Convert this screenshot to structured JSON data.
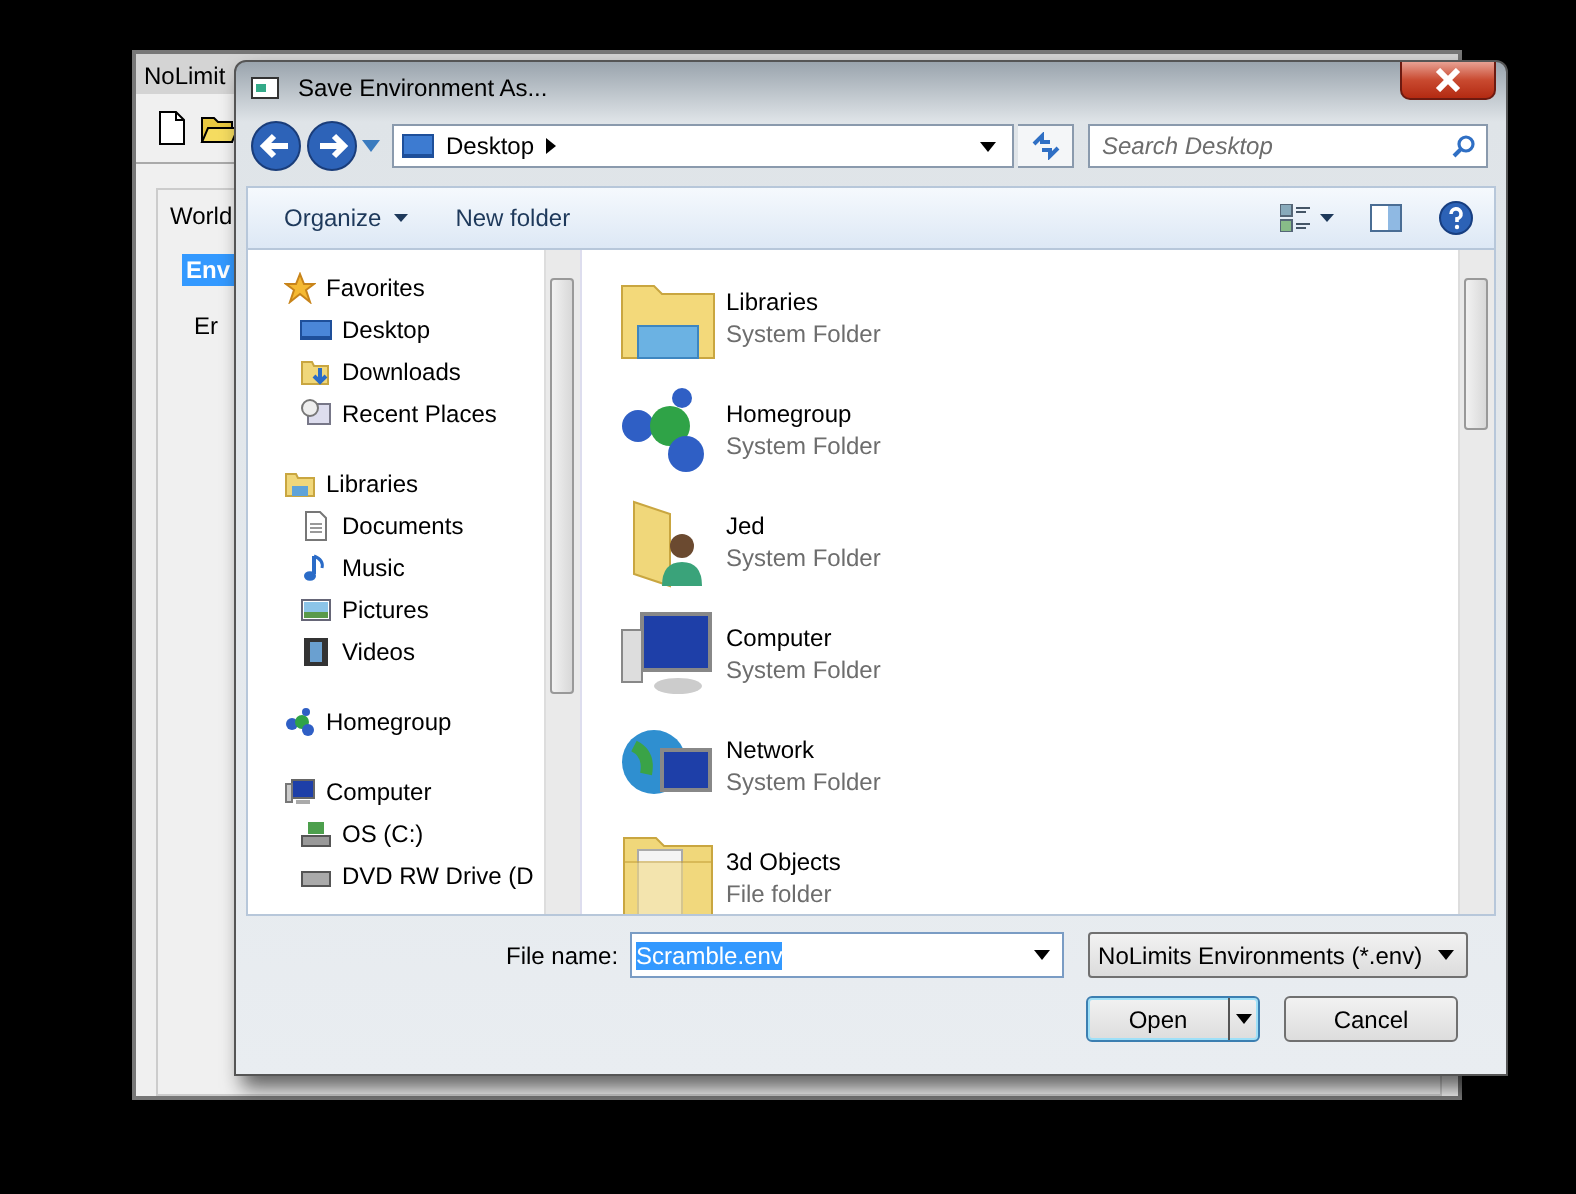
{
  "background_window": {
    "title": "NoLimit",
    "tab_label": "World",
    "items": [
      {
        "label": "Env",
        "selected": true
      },
      {
        "label": "Er",
        "selected": false
      }
    ]
  },
  "dialog": {
    "title": "Save Environment As...",
    "address": "Desktop",
    "search": {
      "placeholder": "Search Desktop"
    },
    "toolbar": {
      "organize": "Organize",
      "new_folder": "New folder"
    },
    "nav_pane": [
      {
        "label": "Favorites",
        "kind": "star",
        "children": [
          {
            "label": "Desktop",
            "kind": "desktop"
          },
          {
            "label": "Downloads",
            "kind": "downloads"
          },
          {
            "label": "Recent Places",
            "kind": "recent"
          }
        ]
      },
      {
        "label": "Libraries",
        "kind": "libraries",
        "children": [
          {
            "label": "Documents",
            "kind": "document"
          },
          {
            "label": "Music",
            "kind": "music"
          },
          {
            "label": "Pictures",
            "kind": "picture"
          },
          {
            "label": "Videos",
            "kind": "video"
          }
        ]
      },
      {
        "label": "Homegroup",
        "kind": "homegroup"
      },
      {
        "label": "Computer",
        "kind": "computer",
        "children": [
          {
            "label": "OS (C:)",
            "kind": "drive"
          },
          {
            "label": "DVD RW Drive (D",
            "kind": "dvd"
          }
        ]
      }
    ],
    "files": [
      {
        "name": "Libraries",
        "type": "System Folder",
        "kind": "libraries"
      },
      {
        "name": "Homegroup",
        "type": "System Folder",
        "kind": "homegroup"
      },
      {
        "name": "Jed",
        "type": "System Folder",
        "kind": "user"
      },
      {
        "name": "Computer",
        "type": "System Folder",
        "kind": "computer"
      },
      {
        "name": "Network",
        "type": "System Folder",
        "kind": "network"
      },
      {
        "name": "3d Objects",
        "type": "File folder",
        "kind": "folder"
      }
    ],
    "file_name": {
      "label": "File name:",
      "value": "Scramble.env",
      "highlighted": true
    },
    "file_type": "NoLimits Environments (*.env)",
    "buttons": {
      "open": "Open",
      "cancel": "Cancel"
    }
  }
}
